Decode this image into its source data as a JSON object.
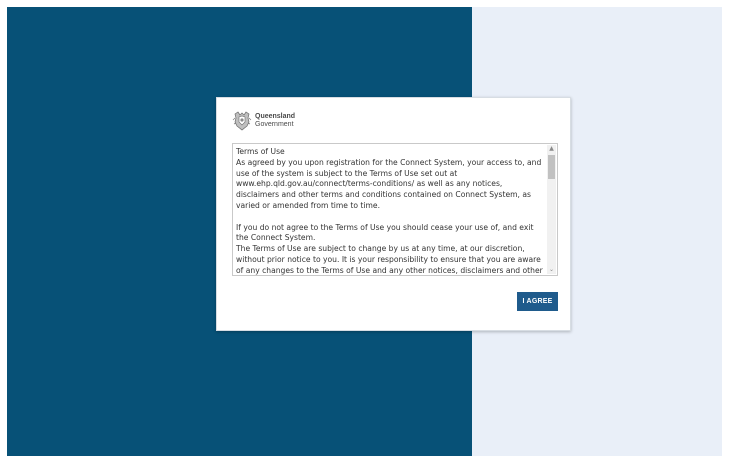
{
  "colors": {
    "left_panel": "#075177",
    "right_panel": "#e9eff8",
    "button": "#1f5b8c"
  },
  "logo": {
    "icon": "queensland-crest-icon",
    "line1": "Queensland",
    "line2": "Government"
  },
  "terms": {
    "paragraphs": [
      "Terms of Use",
      "As agreed by you upon registration for the Connect System, your access to, and use of the system is subject to the Terms of Use set out at www.ehp.qld.gov.au/connect/terms-conditions/ as well as any notices, disclaimers and other terms and conditions contained on Connect System, as varied or amended from time to time.",
      "If you do not agree to the Terms of Use you should cease your use of, and exit the Connect System.",
      "The Terms of Use are subject to change by us at any time, at our discretion, without prior notice to you.  It is your responsibility to ensure that you are aware of any changes to the Terms of Use and any other notices, disclaimers and other terms and conditions."
    ]
  },
  "button": {
    "agree_label": "I AGREE"
  }
}
